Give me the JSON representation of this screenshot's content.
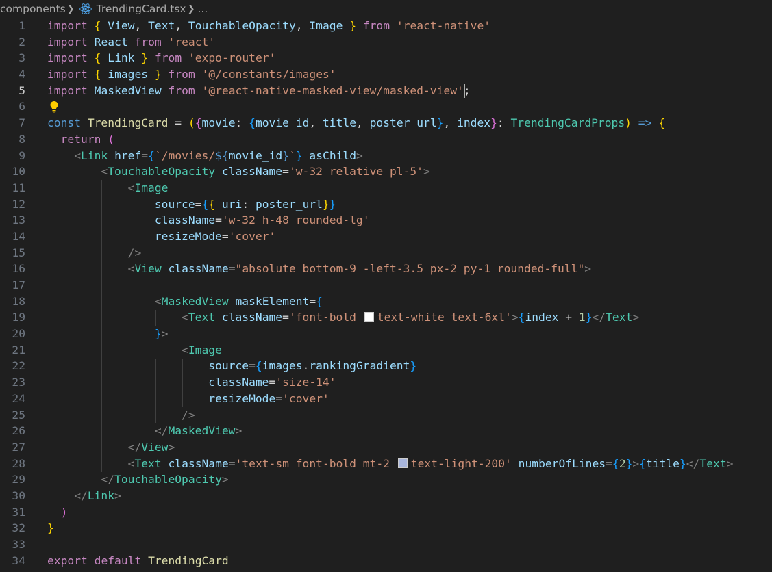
{
  "breadcrumb": {
    "folder": "components",
    "file": "TrendingCard.tsx",
    "more": "..."
  },
  "colors": {
    "background": "#1f1f1f",
    "keyword": "#c586c0",
    "string": "#ce9178",
    "variable": "#9cdcfe",
    "type": "#4ec9b0",
    "bracket": "#ffd700",
    "swatch_white": "#ffffff",
    "swatch_light200": "#a8b5db"
  },
  "active_line": 5,
  "lines": [
    {
      "n": "1",
      "tokens": [
        [
          "k",
          "import"
        ],
        [
          "d",
          " "
        ],
        [
          "b1",
          "{"
        ],
        [
          "d",
          " "
        ],
        [
          "v",
          "View"
        ],
        [
          "d",
          ", "
        ],
        [
          "v",
          "Text"
        ],
        [
          "d",
          ", "
        ],
        [
          "v",
          "TouchableOpacity"
        ],
        [
          "d",
          ", "
        ],
        [
          "v",
          "Image"
        ],
        [
          "d",
          " "
        ],
        [
          "b1",
          "}"
        ],
        [
          "d",
          " "
        ],
        [
          "k",
          "from"
        ],
        [
          "d",
          " "
        ],
        [
          "s",
          "'react-native'"
        ]
      ]
    },
    {
      "n": "2",
      "tokens": [
        [
          "k",
          "import"
        ],
        [
          "d",
          " "
        ],
        [
          "v",
          "React"
        ],
        [
          "d",
          " "
        ],
        [
          "k",
          "from"
        ],
        [
          "d",
          " "
        ],
        [
          "s",
          "'react'"
        ]
      ]
    },
    {
      "n": "3",
      "tokens": [
        [
          "k",
          "import"
        ],
        [
          "d",
          " "
        ],
        [
          "b1",
          "{"
        ],
        [
          "d",
          " "
        ],
        [
          "v",
          "Link"
        ],
        [
          "d",
          " "
        ],
        [
          "b1",
          "}"
        ],
        [
          "d",
          " "
        ],
        [
          "k",
          "from"
        ],
        [
          "d",
          " "
        ],
        [
          "s",
          "'expo-router'"
        ]
      ]
    },
    {
      "n": "4",
      "tokens": [
        [
          "k",
          "import"
        ],
        [
          "d",
          " "
        ],
        [
          "b1",
          "{"
        ],
        [
          "d",
          " "
        ],
        [
          "v",
          "images"
        ],
        [
          "d",
          " "
        ],
        [
          "b1",
          "}"
        ],
        [
          "d",
          " "
        ],
        [
          "k",
          "from"
        ],
        [
          "d",
          " "
        ],
        [
          "s",
          "'@/constants/images'"
        ]
      ]
    },
    {
      "n": "5",
      "tokens": [
        [
          "k",
          "import"
        ],
        [
          "d",
          " "
        ],
        [
          "v",
          "MaskedView"
        ],
        [
          "d",
          " "
        ],
        [
          "k",
          "from"
        ],
        [
          "d",
          " "
        ],
        [
          "s",
          "'@react-native-masked-view/masked-view'"
        ],
        [
          "d",
          ";"
        ]
      ]
    },
    {
      "n": "6",
      "tokens": []
    },
    {
      "n": "7",
      "tokens": [
        [
          "kb",
          "const"
        ],
        [
          "d",
          " "
        ],
        [
          "f",
          "TrendingCard"
        ],
        [
          "d",
          " = "
        ],
        [
          "b1",
          "("
        ],
        [
          "b2",
          "{"
        ],
        [
          "v",
          "movie"
        ],
        [
          "d",
          ": "
        ],
        [
          "b3",
          "{"
        ],
        [
          "v",
          "movie_id"
        ],
        [
          "d",
          ", "
        ],
        [
          "v",
          "title"
        ],
        [
          "d",
          ", "
        ],
        [
          "v",
          "poster_url"
        ],
        [
          "b3",
          "}"
        ],
        [
          "d",
          ", "
        ],
        [
          "v",
          "index"
        ],
        [
          "b2",
          "}"
        ],
        [
          "d",
          ": "
        ],
        [
          "t",
          "TrendingCardProps"
        ],
        [
          "b1",
          ")"
        ],
        [
          "d",
          " "
        ],
        [
          "kb",
          "=>"
        ],
        [
          "d",
          " "
        ],
        [
          "b1",
          "{"
        ]
      ]
    },
    {
      "n": "8",
      "tokens": [
        [
          "d",
          "  "
        ],
        [
          "k",
          "return"
        ],
        [
          "d",
          " "
        ],
        [
          "b2",
          "("
        ]
      ]
    },
    {
      "n": "9",
      "tokens": [
        [
          "d",
          "    "
        ],
        [
          "p",
          "<"
        ],
        [
          "t",
          "Link"
        ],
        [
          "d",
          " "
        ],
        [
          "v",
          "href"
        ],
        [
          "d",
          "="
        ],
        [
          "b3",
          "{"
        ],
        [
          "s",
          "`/movies/"
        ],
        [
          "kb",
          "${"
        ],
        [
          "v",
          "movie_id"
        ],
        [
          "kb",
          "}"
        ],
        [
          "s",
          "`"
        ],
        [
          "b3",
          "}"
        ],
        [
          "d",
          " "
        ],
        [
          "v",
          "asChild"
        ],
        [
          "p",
          ">"
        ]
      ]
    },
    {
      "n": "10",
      "tokens": [
        [
          "d",
          "        "
        ],
        [
          "p",
          "<"
        ],
        [
          "t",
          "TouchableOpacity"
        ],
        [
          "d",
          " "
        ],
        [
          "v",
          "className"
        ],
        [
          "d",
          "="
        ],
        [
          "s",
          "'w-32 relative pl-5'"
        ],
        [
          "p",
          ">"
        ]
      ]
    },
    {
      "n": "11",
      "tokens": [
        [
          "d",
          "            "
        ],
        [
          "p",
          "<"
        ],
        [
          "t",
          "Image"
        ]
      ]
    },
    {
      "n": "12",
      "tokens": [
        [
          "d",
          "                "
        ],
        [
          "v",
          "source"
        ],
        [
          "d",
          "="
        ],
        [
          "b3",
          "{"
        ],
        [
          "b1",
          "{"
        ],
        [
          "d",
          " "
        ],
        [
          "v",
          "uri"
        ],
        [
          "d",
          ": "
        ],
        [
          "v",
          "poster_url"
        ],
        [
          "b1",
          "}"
        ],
        [
          "b3",
          "}"
        ]
      ]
    },
    {
      "n": "13",
      "tokens": [
        [
          "d",
          "                "
        ],
        [
          "v",
          "className"
        ],
        [
          "d",
          "="
        ],
        [
          "s",
          "'w-32 h-48 rounded-lg'"
        ]
      ]
    },
    {
      "n": "14",
      "tokens": [
        [
          "d",
          "                "
        ],
        [
          "v",
          "resizeMode"
        ],
        [
          "d",
          "="
        ],
        [
          "s",
          "'cover'"
        ]
      ]
    },
    {
      "n": "15",
      "tokens": [
        [
          "d",
          "            "
        ],
        [
          "p",
          "/>"
        ]
      ]
    },
    {
      "n": "16",
      "tokens": [
        [
          "d",
          "            "
        ],
        [
          "p",
          "<"
        ],
        [
          "t",
          "View"
        ],
        [
          "d",
          " "
        ],
        [
          "v",
          "className"
        ],
        [
          "d",
          "="
        ],
        [
          "s",
          "\"absolute bottom-9 -left-3.5 px-2 py-1 rounded-full\""
        ],
        [
          "p",
          ">"
        ]
      ]
    },
    {
      "n": "17",
      "tokens": []
    },
    {
      "n": "18",
      "tokens": [
        [
          "d",
          "                "
        ],
        [
          "p",
          "<"
        ],
        [
          "t",
          "MaskedView"
        ],
        [
          "d",
          " "
        ],
        [
          "v",
          "maskElement"
        ],
        [
          "d",
          "="
        ],
        [
          "b3",
          "{"
        ]
      ]
    },
    {
      "n": "19",
      "tokens": [
        [
          "d",
          "                    "
        ],
        [
          "p",
          "<"
        ],
        [
          "t",
          "Text"
        ],
        [
          "d",
          " "
        ],
        [
          "v",
          "className"
        ],
        [
          "d",
          "="
        ],
        [
          "s",
          "'font-bold "
        ],
        [
          "sw",
          "#ffffff"
        ],
        [
          "s",
          "text-white text-6xl'"
        ],
        [
          "p",
          ">"
        ],
        [
          "b3",
          "{"
        ],
        [
          "v",
          "index"
        ],
        [
          "d",
          " + "
        ],
        [
          "n",
          "1"
        ],
        [
          "b3",
          "}"
        ],
        [
          "p",
          "</"
        ],
        [
          "t",
          "Text"
        ],
        [
          "p",
          ">"
        ]
      ]
    },
    {
      "n": "20",
      "tokens": [
        [
          "d",
          "                "
        ],
        [
          "b3",
          "}"
        ],
        [
          "p",
          ">"
        ]
      ]
    },
    {
      "n": "21",
      "tokens": [
        [
          "d",
          "                    "
        ],
        [
          "p",
          "<"
        ],
        [
          "t",
          "Image"
        ]
      ]
    },
    {
      "n": "22",
      "tokens": [
        [
          "d",
          "                        "
        ],
        [
          "v",
          "source"
        ],
        [
          "d",
          "="
        ],
        [
          "b3",
          "{"
        ],
        [
          "v",
          "images"
        ],
        [
          "d",
          "."
        ],
        [
          "v",
          "rankingGradient"
        ],
        [
          "b3",
          "}"
        ]
      ]
    },
    {
      "n": "23",
      "tokens": [
        [
          "d",
          "                        "
        ],
        [
          "v",
          "className"
        ],
        [
          "d",
          "="
        ],
        [
          "s",
          "'size-14'"
        ]
      ]
    },
    {
      "n": "24",
      "tokens": [
        [
          "d",
          "                        "
        ],
        [
          "v",
          "resizeMode"
        ],
        [
          "d",
          "="
        ],
        [
          "s",
          "'cover'"
        ]
      ]
    },
    {
      "n": "25",
      "tokens": [
        [
          "d",
          "                    "
        ],
        [
          "p",
          "/>"
        ]
      ]
    },
    {
      "n": "26",
      "tokens": [
        [
          "d",
          "                "
        ],
        [
          "p",
          "</"
        ],
        [
          "t",
          "MaskedView"
        ],
        [
          "p",
          ">"
        ]
      ]
    },
    {
      "n": "27",
      "tokens": [
        [
          "d",
          "            "
        ],
        [
          "p",
          "</"
        ],
        [
          "t",
          "View"
        ],
        [
          "p",
          ">"
        ]
      ]
    },
    {
      "n": "28",
      "tokens": [
        [
          "d",
          "            "
        ],
        [
          "p",
          "<"
        ],
        [
          "t",
          "Text"
        ],
        [
          "d",
          " "
        ],
        [
          "v",
          "className"
        ],
        [
          "d",
          "="
        ],
        [
          "s",
          "'text-sm font-bold mt-2 "
        ],
        [
          "sw",
          "#a8b5db"
        ],
        [
          "s",
          "text-light-200'"
        ],
        [
          "d",
          " "
        ],
        [
          "v",
          "numberOfLines"
        ],
        [
          "d",
          "="
        ],
        [
          "b3",
          "{"
        ],
        [
          "n",
          "2"
        ],
        [
          "b3",
          "}"
        ],
        [
          "p",
          ">"
        ],
        [
          "b3",
          "{"
        ],
        [
          "v",
          "title"
        ],
        [
          "b3",
          "}"
        ],
        [
          "p",
          "</"
        ],
        [
          "t",
          "Text"
        ],
        [
          "p",
          ">"
        ]
      ]
    },
    {
      "n": "29",
      "tokens": [
        [
          "d",
          "        "
        ],
        [
          "p",
          "</"
        ],
        [
          "t",
          "TouchableOpacity"
        ],
        [
          "p",
          ">"
        ]
      ]
    },
    {
      "n": "30",
      "tokens": [
        [
          "d",
          "    "
        ],
        [
          "p",
          "</"
        ],
        [
          "t",
          "Link"
        ],
        [
          "p",
          ">"
        ]
      ]
    },
    {
      "n": "31",
      "tokens": [
        [
          "d",
          "  "
        ],
        [
          "b2",
          ")"
        ]
      ]
    },
    {
      "n": "32",
      "tokens": [
        [
          "b1",
          "}"
        ]
      ]
    },
    {
      "n": "33",
      "tokens": []
    },
    {
      "n": "34",
      "tokens": [
        [
          "k",
          "export"
        ],
        [
          "d",
          " "
        ],
        [
          "k",
          "default"
        ],
        [
          "d",
          " "
        ],
        [
          "f",
          "TrendingCard"
        ]
      ]
    }
  ]
}
